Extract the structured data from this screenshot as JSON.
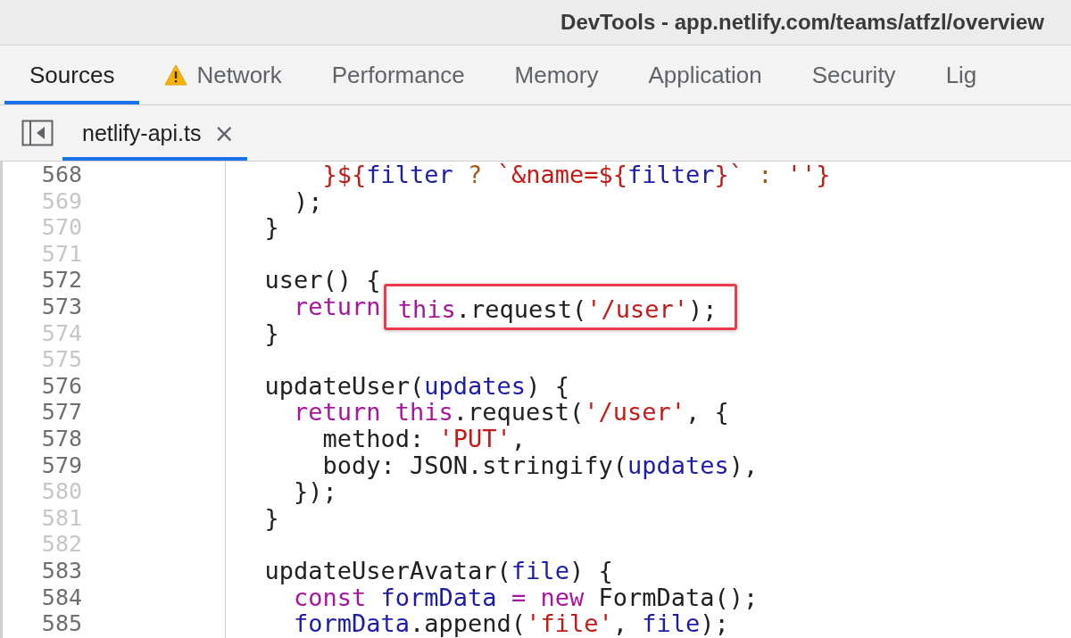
{
  "window": {
    "title": "DevTools - app.netlify.com/teams/atfzl/overview"
  },
  "panel_tabs": [
    {
      "label": "Sources",
      "selected": true,
      "warning": false
    },
    {
      "label": "Network",
      "selected": false,
      "warning": true
    },
    {
      "label": "Performance",
      "selected": false,
      "warning": false
    },
    {
      "label": "Memory",
      "selected": false,
      "warning": false
    },
    {
      "label": "Application",
      "selected": false,
      "warning": false
    },
    {
      "label": "Security",
      "selected": false,
      "warning": false
    },
    {
      "label": "Lig",
      "selected": false,
      "warning": false
    }
  ],
  "file_tabs": [
    {
      "label": "netlify-api.ts",
      "selected": true,
      "close": "×"
    }
  ],
  "editor": {
    "lines": [
      {
        "number": "568",
        "executable": true,
        "segments": [
          {
            "kind": "code",
            "tokens": [
              {
                "kind": "str",
                "s": "      }${"
              },
              {
                "kind": "var",
                "s": "filter"
              },
              {
                "kind": "op",
                "s": " ? "
              },
              {
                "kind": "str",
                "s": "`&name=${"
              },
              {
                "kind": "var",
                "s": "filter"
              },
              {
                "kind": "str",
                "s": "}`"
              },
              {
                "kind": "op",
                "s": " : "
              },
              {
                "kind": "str",
                "s": "''}"
              }
            ]
          }
        ]
      },
      {
        "number": "569",
        "executable": false,
        "segments": [
          {
            "kind": "code",
            "tokens": [
              {
                "kind": "plain",
                "s": "    );"
              }
            ]
          }
        ]
      },
      {
        "number": "570",
        "executable": false,
        "segments": [
          {
            "kind": "code",
            "tokens": [
              {
                "kind": "plain",
                "s": "  }"
              }
            ]
          }
        ]
      },
      {
        "number": "571",
        "executable": false
      },
      {
        "number": "572",
        "executable": true,
        "segments": [
          {
            "kind": "code",
            "tokens": [
              {
                "kind": "plain",
                "s": "  user() {"
              }
            ]
          }
        ]
      },
      {
        "number": "573",
        "executable": true,
        "segments": [
          {
            "kind": "code",
            "tokens": [
              {
                "kind": "kw",
                "s": "    return "
              }
            ]
          },
          {
            "kind": "callout",
            "tokens": [
              {
                "kind": "kw",
                "s": "this"
              },
              {
                "kind": "plain",
                "s": ".request("
              },
              {
                "kind": "str",
                "s": "'/user'"
              },
              {
                "kind": "plain",
                "s": ");"
              }
            ]
          }
        ]
      },
      {
        "number": "574",
        "executable": false,
        "segments": [
          {
            "kind": "code",
            "tokens": [
              {
                "kind": "plain",
                "s": "  }"
              }
            ]
          }
        ]
      },
      {
        "number": "575",
        "executable": false
      },
      {
        "number": "576",
        "executable": true,
        "segments": [
          {
            "kind": "code",
            "tokens": [
              {
                "kind": "plain",
                "s": "  updateUser("
              },
              {
                "kind": "var",
                "s": "updates"
              },
              {
                "kind": "plain",
                "s": ") {"
              }
            ]
          }
        ]
      },
      {
        "number": "577",
        "executable": true,
        "segments": [
          {
            "kind": "code",
            "tokens": [
              {
                "kind": "kw",
                "s": "    return this"
              },
              {
                "kind": "plain",
                "s": ".request("
              },
              {
                "kind": "str",
                "s": "'/user'"
              },
              {
                "kind": "plain",
                "s": ", {"
              }
            ]
          }
        ]
      },
      {
        "number": "578",
        "executable": true,
        "segments": [
          {
            "kind": "code",
            "tokens": [
              {
                "kind": "plain",
                "s": "      method: "
              },
              {
                "kind": "str",
                "s": "'PUT'"
              },
              {
                "kind": "plain",
                "s": ","
              }
            ]
          }
        ]
      },
      {
        "number": "579",
        "executable": true,
        "segments": [
          {
            "kind": "code",
            "tokens": [
              {
                "kind": "plain",
                "s": "      body: JSON.stringify("
              },
              {
                "kind": "var",
                "s": "updates"
              },
              {
                "kind": "plain",
                "s": "),"
              }
            ]
          }
        ]
      },
      {
        "number": "580",
        "executable": false,
        "segments": [
          {
            "kind": "code",
            "tokens": [
              {
                "kind": "plain",
                "s": "    });"
              }
            ]
          }
        ]
      },
      {
        "number": "581",
        "executable": false,
        "segments": [
          {
            "kind": "code",
            "tokens": [
              {
                "kind": "plain",
                "s": "  }"
              }
            ]
          }
        ]
      },
      {
        "number": "582",
        "executable": false
      },
      {
        "number": "583",
        "executable": true,
        "segments": [
          {
            "kind": "code",
            "tokens": [
              {
                "kind": "plain",
                "s": "  updateUserAvatar("
              },
              {
                "kind": "var",
                "s": "file"
              },
              {
                "kind": "plain",
                "s": ") {"
              }
            ]
          }
        ]
      },
      {
        "number": "584",
        "executable": true,
        "segments": [
          {
            "kind": "code",
            "tokens": [
              {
                "kind": "kw",
                "s": "    const"
              },
              {
                "kind": "var",
                "s": " formData"
              },
              {
                "kind": "kw",
                "s": " = new"
              },
              {
                "kind": "plain",
                "s": " FormData();"
              }
            ]
          }
        ]
      },
      {
        "number": "585",
        "executable": true,
        "segments": [
          {
            "kind": "code",
            "tokens": [
              {
                "kind": "var",
                "s": "    formData"
              },
              {
                "kind": "plain",
                "s": ".append("
              },
              {
                "kind": "str",
                "s": "'file'"
              },
              {
                "kind": "plain",
                "s": ", "
              },
              {
                "kind": "var",
                "s": "file"
              },
              {
                "kind": "plain",
                "s": ");"
              }
            ]
          }
        ]
      }
    ]
  }
}
